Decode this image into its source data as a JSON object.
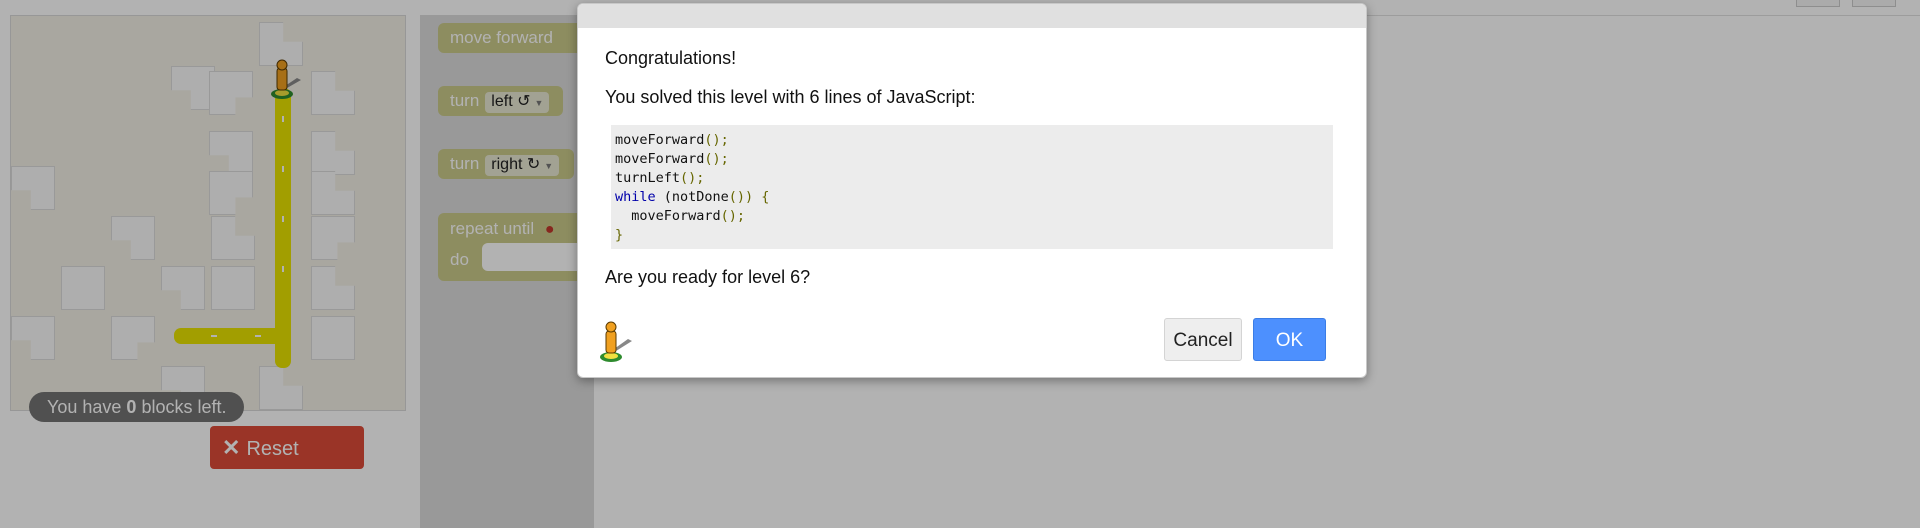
{
  "maze": {
    "status_prefix": "You have ",
    "blocks_left": "0",
    "status_suffix": " blocks left."
  },
  "reset_button": {
    "label": "Reset",
    "icon": "x-icon"
  },
  "toolbox": {
    "move_forward": "move forward",
    "turn_left": {
      "label": "turn",
      "option": "left ↺"
    },
    "turn_right": {
      "label": "turn",
      "option": "right ↻"
    },
    "repeat_until": {
      "label": "repeat until",
      "do_label": "do",
      "icon": "marker-icon"
    }
  },
  "dialog": {
    "congrats": "Congratulations!",
    "solved_text": "You solved this level with 6 lines of JavaScript:",
    "code": [
      [
        {
          "t": "moveForward",
          "c": ""
        },
        {
          "t": "();",
          "c": "punct"
        }
      ],
      [
        {
          "t": "moveForward",
          "c": ""
        },
        {
          "t": "();",
          "c": "punct"
        }
      ],
      [
        {
          "t": "turnLeft",
          "c": ""
        },
        {
          "t": "();",
          "c": "punct"
        }
      ],
      [
        {
          "t": "while",
          "c": "kw"
        },
        {
          "t": " (notDone",
          "c": ""
        },
        {
          "t": "()) {",
          "c": "punct"
        }
      ],
      [
        {
          "t": "  moveForward",
          "c": ""
        },
        {
          "t": "();",
          "c": "punct"
        }
      ],
      [
        {
          "t": "}",
          "c": "punct"
        }
      ]
    ],
    "ready_text": "Are you ready for level 6?",
    "cancel_label": "Cancel",
    "ok_label": "OK",
    "icon": "pegman-icon"
  },
  "colors": {
    "reset": "#dd4b39",
    "ok": "#4d90fe",
    "path": "#e8e200",
    "block": "#cbca8a",
    "keyword": "#0000aa",
    "punctuation": "#666600"
  }
}
